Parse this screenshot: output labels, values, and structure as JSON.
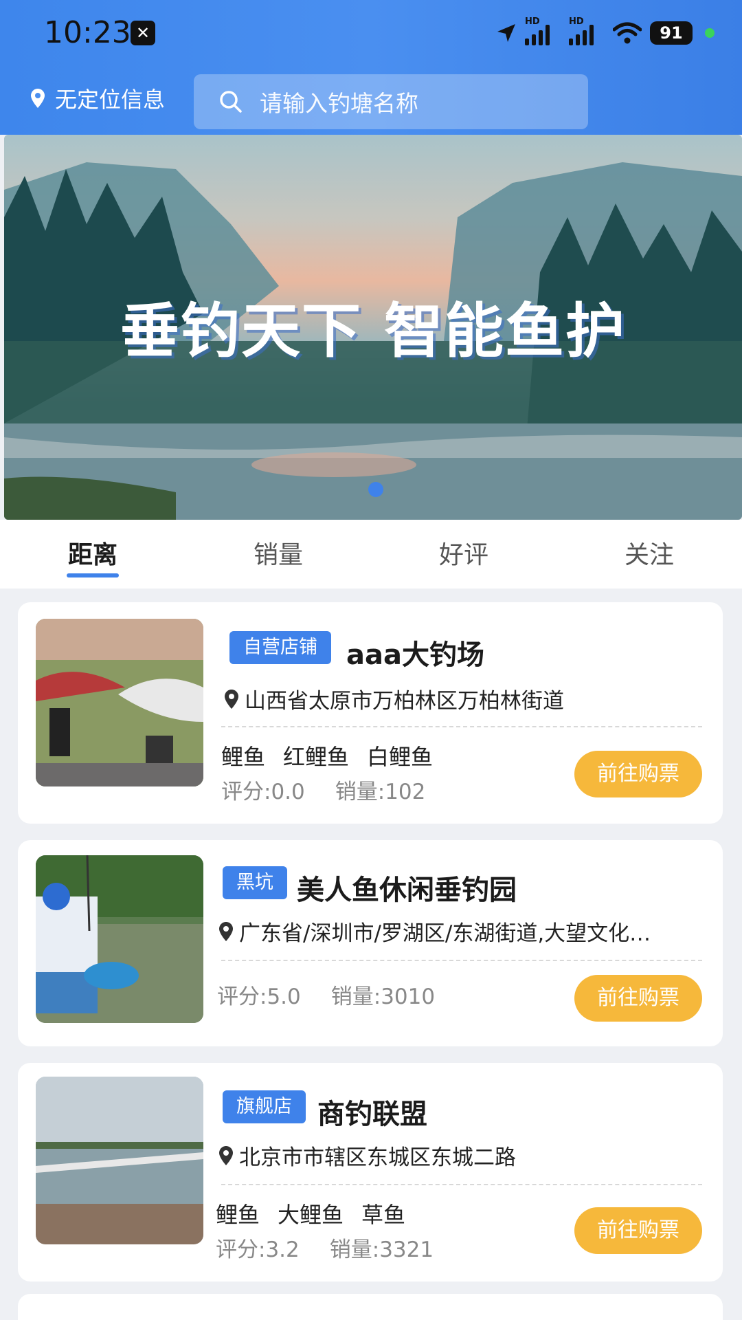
{
  "status_bar": {
    "time": "10:23",
    "battery": "91"
  },
  "header": {
    "location_label": "无定位信息",
    "search_placeholder": "请输入钓塘名称"
  },
  "banner": {
    "title": "垂钓天下  智能鱼护"
  },
  "tabs": [
    {
      "label": "距离",
      "active": true
    },
    {
      "label": "销量",
      "active": false
    },
    {
      "label": "好评",
      "active": false
    },
    {
      "label": "关注",
      "active": false
    }
  ],
  "venues": [
    {
      "tag": "自营店铺",
      "name": "aaa大钓场",
      "address": "山西省太原市万柏林区万柏林街道",
      "fish": [
        "鲤鱼",
        "红鲤鱼",
        "白鲤鱼"
      ],
      "score": "评分:0.0",
      "sales": "销量:102",
      "button": "前往购票"
    },
    {
      "tag": "黑坑",
      "name": "美人鱼休闲垂钓园",
      "address": "广东省/深圳市/罗湖区/东湖街道,大望文化…",
      "fish": [],
      "score": "评分:5.0",
      "sales": "销量:3010",
      "button": "前往购票"
    },
    {
      "tag": "旗舰店",
      "name": "商钓联盟",
      "address": "北京市市辖区东城区东城二路",
      "fish": [
        "鲤鱼",
        "大鲤鱼",
        "草鱼"
      ],
      "score": "评分:3.2",
      "sales": "销量:3321",
      "button": "前往购票"
    }
  ],
  "colors": {
    "primary": "#3f82ea",
    "button": "#f6b83b"
  }
}
